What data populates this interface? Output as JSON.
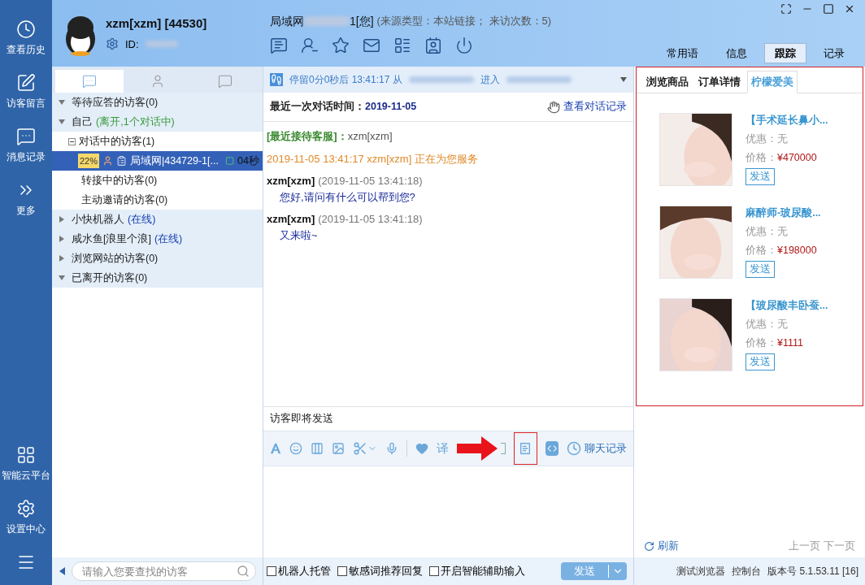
{
  "sidebar": {
    "top_items": [
      {
        "kind": "history",
        "label": "查看历史"
      },
      {
        "kind": "note",
        "label": "访客留言"
      },
      {
        "kind": "messages",
        "label": "消息记录"
      },
      {
        "kind": "more",
        "label": "更多"
      }
    ],
    "bottom_items": [
      {
        "kind": "cloud",
        "label": "智能云平台"
      },
      {
        "kind": "settings",
        "label": "设置中心"
      },
      {
        "kind": "menu"
      }
    ]
  },
  "agent": {
    "name": "xzm[xzm] [44530]",
    "id_label": "ID:"
  },
  "visitor_title": {
    "prefix": "局域网",
    "suffix": "1[您]",
    "meta": "(来源类型：本站链接；  来访次数：5)"
  },
  "right_tabs": [
    {
      "label": "常用语",
      "selected": false
    },
    {
      "label": "信息",
      "selected": false
    },
    {
      "label": "跟踪",
      "selected": true
    },
    {
      "label": "记录",
      "selected": false
    }
  ],
  "visitor_tabs": [
    {
      "kind": "chat",
      "selected": true
    },
    {
      "kind": "person",
      "selected": false
    },
    {
      "kind": "message",
      "selected": false
    }
  ],
  "tree": [
    {
      "label": "等待应答的访客(0)",
      "expanded": true
    },
    {
      "label": "自己",
      "status": "(离开,1个对话中)",
      "color": "#3a9a3a",
      "expanded": true,
      "children": [
        {
          "label": "对话中的访客(1)",
          "expanded": true,
          "children": [
            {
              "kind": "visitor",
              "badge": "22%",
              "label": "局域网|434729-1[...",
              "timer": "04秒",
              "selected": true
            }
          ]
        },
        {
          "label": "转接中的访客(0)"
        },
        {
          "label": "主动邀请的访客(0)"
        }
      ]
    },
    {
      "label": "小快机器人",
      "status": "(在线)",
      "color": "#1a3fb0",
      "expanded": false
    },
    {
      "label": "咸水鱼[浪里个浪]",
      "status": "(在线)",
      "color": "#1a3fb0",
      "expanded": false
    },
    {
      "label": "浏览网站的访客(0)",
      "expanded": false
    },
    {
      "label": "已离开的访客(0)",
      "expanded": true
    }
  ],
  "search": {
    "placeholder": "请输入您要查找的访客"
  },
  "track_bar": {
    "text": "停留0分0秒后 13:41:17 从",
    "joiner": "进入"
  },
  "last_chat": {
    "label": "最近一次对话时间：",
    "date": "2019-11-05",
    "link": "查看对话记录"
  },
  "messages": [
    {
      "kind": "recent",
      "label": "[最近接待客服]：",
      "text": "xzm[xzm]"
    },
    {
      "kind": "system",
      "text": "2019-11-05 13:41:17 xzm[xzm] 正在为您服务"
    },
    {
      "kind": "chat",
      "sender": "xzm[xzm]",
      "time": "(2019-11-05 13:41:18)",
      "text": "您好,请问有什么可以帮到您?"
    },
    {
      "kind": "chat",
      "sender": "xzm[xzm]",
      "time": "(2019-11-05 13:41:18)",
      "text": "又来啦~"
    }
  ],
  "pending": "访客即将发送",
  "toolbar_translate": "译",
  "toolbar_history": "聊天记录",
  "options": [
    {
      "label": "机器人托管",
      "checked": false
    },
    {
      "label": "敏感词推荐回复",
      "checked": false
    },
    {
      "label": "开启智能辅助输入",
      "checked": false
    }
  ],
  "send_button": "发送",
  "sub_tabs": [
    {
      "label": "浏览商品",
      "selected": false
    },
    {
      "label": "订单详情",
      "selected": false
    },
    {
      "label": "柠檬爱美",
      "selected": true
    }
  ],
  "products": [
    {
      "title": "【手术延长鼻小...",
      "discount": "优惠：无",
      "price_label": "价格：",
      "price": "¥470000",
      "button": "发送"
    },
    {
      "title": "麻醉师-玻尿酸...",
      "discount": "优惠：无",
      "price_label": "价格：",
      "price": "¥198000",
      "button": "发送"
    },
    {
      "title": "【玻尿酸丰卧蚕...",
      "discount": "优惠：无",
      "price_label": "价格：",
      "price": "¥1111",
      "button": "发送"
    }
  ],
  "refresh": "刷新",
  "prev": "上一页",
  "next": "下一页",
  "status_bar": {
    "items": [
      "测试浏览器",
      "控制台"
    ],
    "version": "版本号 5.1.53.11 [16]"
  }
}
